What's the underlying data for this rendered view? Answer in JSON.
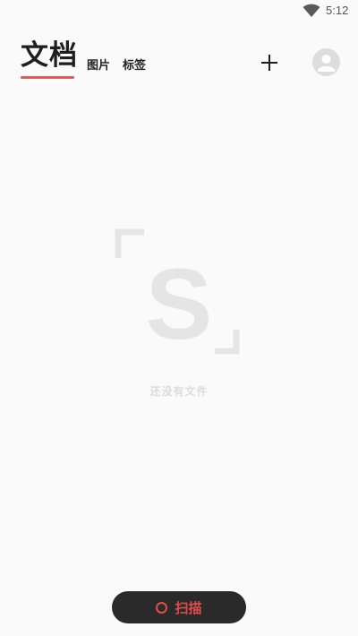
{
  "status_bar": {
    "time": "5:12",
    "wifi_icon": "wifi-icon"
  },
  "header": {
    "tabs": [
      {
        "label": "文档",
        "active": true
      },
      {
        "label": "图片",
        "active": false
      },
      {
        "label": "标签",
        "active": false
      }
    ],
    "add_icon": "plus-icon",
    "avatar_icon": "user-avatar-icon"
  },
  "empty_state": {
    "logo_letter": "S",
    "message": "还没有文件"
  },
  "scan_button": {
    "label": "扫描",
    "icon": "circle-icon"
  },
  "colors": {
    "accent": "#e05a57",
    "background": "#fafafa",
    "scan_button_bg": "#2a2a2a",
    "empty_gray": "#e5e5e5"
  }
}
